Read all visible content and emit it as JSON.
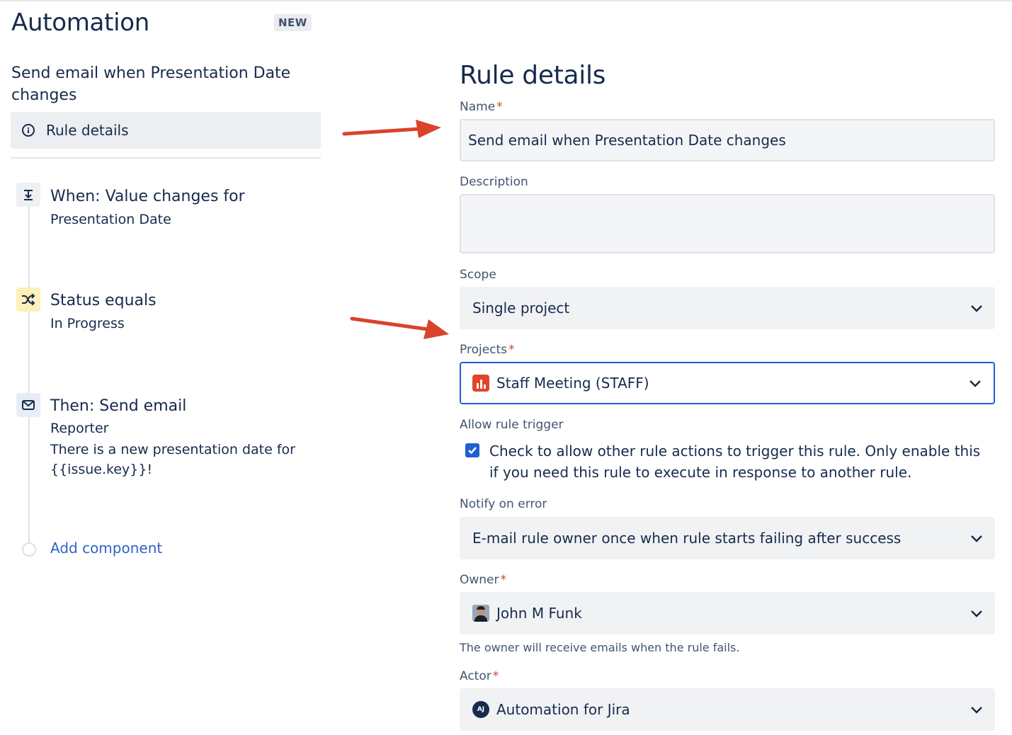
{
  "header": {
    "title": "Automation",
    "badge": "NEW"
  },
  "left": {
    "rule_name": "Send email when Presentation Date changes",
    "nav_item": "Rule details",
    "steps": [
      {
        "title": "When: Value changes for",
        "lines": [
          "Presentation Date"
        ],
        "icon": "field-change-icon"
      },
      {
        "title": "Status equals",
        "lines": [
          "In Progress"
        ],
        "icon": "shuffle-icon"
      },
      {
        "title": "Then: Send email",
        "lines": [
          "Reporter",
          "There is a new presentation date for {{issue.key}}!"
        ],
        "icon": "mail-icon"
      }
    ],
    "add_component": "Add component"
  },
  "details": {
    "heading": "Rule details",
    "name": {
      "label": "Name",
      "required": "*",
      "value": "Send email when Presentation Date changes"
    },
    "description": {
      "label": "Description",
      "value": ""
    },
    "scope": {
      "label": "Scope",
      "value": "Single project"
    },
    "projects": {
      "label": "Projects",
      "required": "*",
      "value": "Staff Meeting (STAFF)"
    },
    "allow_trigger": {
      "label": "Allow rule trigger",
      "checked": true,
      "text": "Check to allow other rule actions to trigger this rule. Only enable this if you need this rule to execute in response to another rule."
    },
    "notify": {
      "label": "Notify on error",
      "value": "E-mail rule owner once when rule starts failing after success"
    },
    "owner": {
      "label": "Owner",
      "required": "*",
      "value": "John M Funk",
      "helper": "The owner will receive emails when the rule fails."
    },
    "actor": {
      "label": "Actor",
      "required": "*",
      "value": "Automation for Jira",
      "avatar_initials": "AJ"
    }
  },
  "colors": {
    "accent": "#1f5fd1",
    "required": "#d6422b",
    "arrow": "#d9432a",
    "link": "#2f63c7"
  }
}
